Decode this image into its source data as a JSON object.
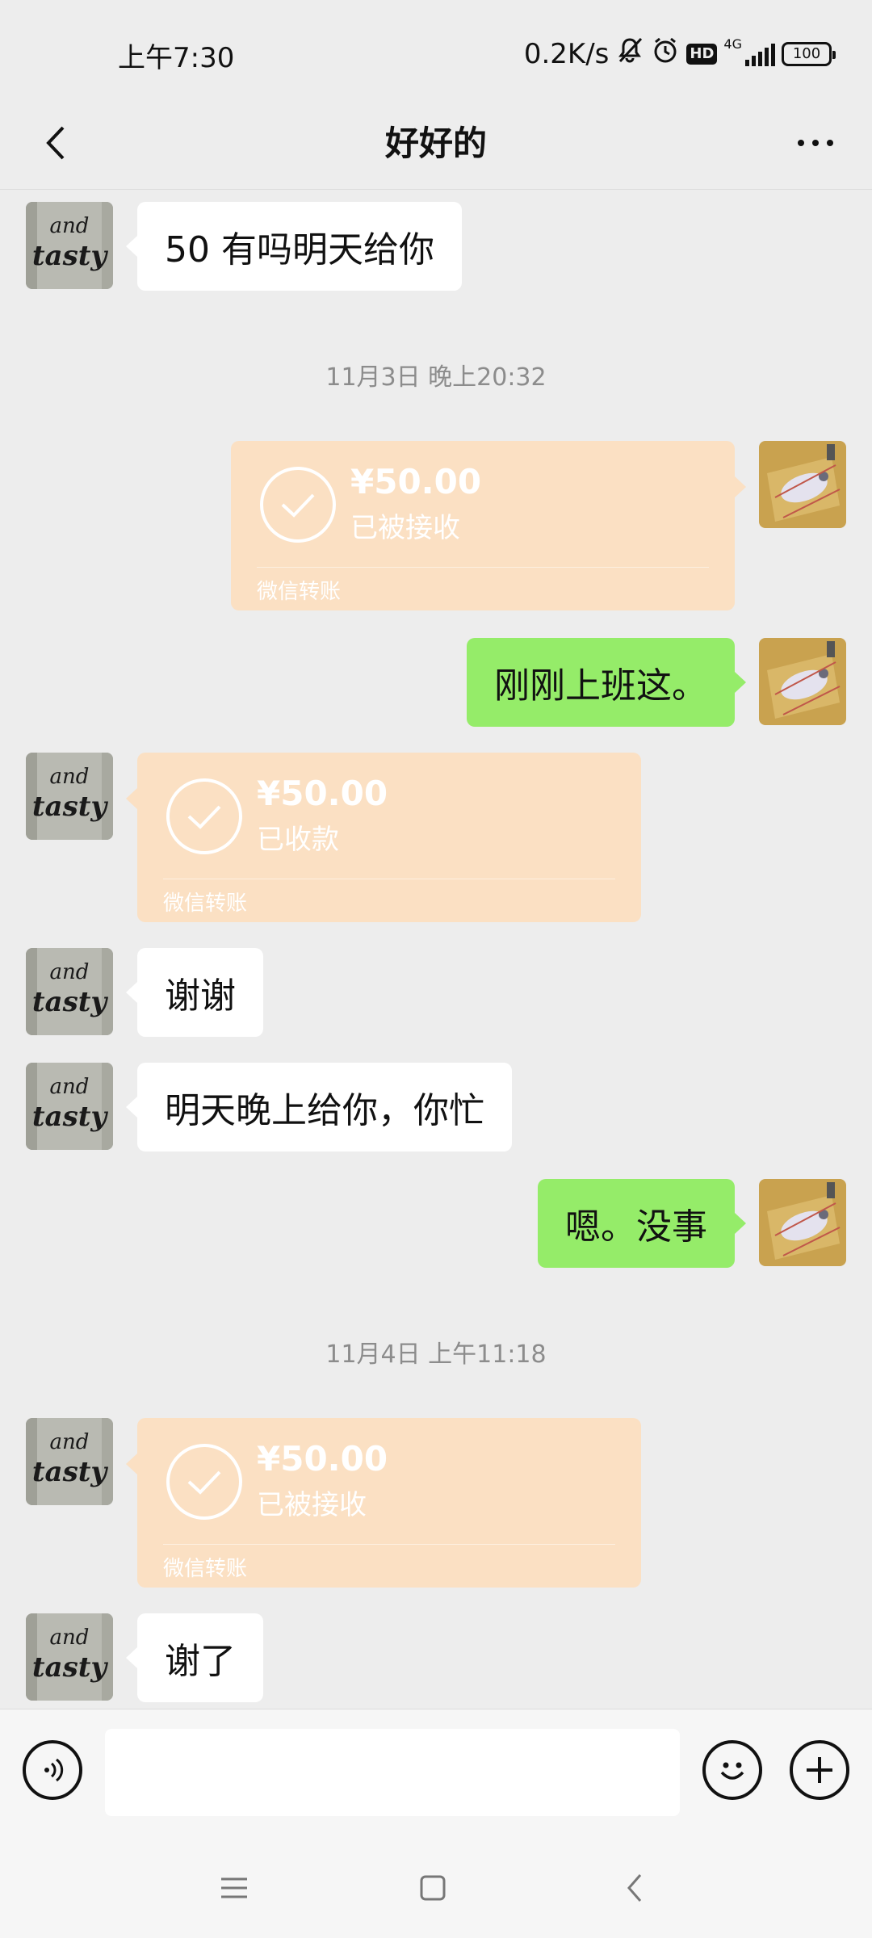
{
  "status_bar": {
    "time": "上午7:30",
    "speed": "0.2K/s",
    "network": "4G",
    "hd": "HD",
    "battery": "100"
  },
  "header": {
    "title": "好好的"
  },
  "messages": [
    {
      "type": "text",
      "side": "left",
      "text": "50 有吗明天给你"
    },
    {
      "type": "time",
      "text": "11月3日 晚上20:32"
    },
    {
      "type": "transfer",
      "side": "right",
      "amount": "¥50.00",
      "status": "已被接收",
      "label": "微信转账"
    },
    {
      "type": "text",
      "side": "right",
      "text": "刚刚上班这。"
    },
    {
      "type": "transfer",
      "side": "left",
      "amount": "¥50.00",
      "status": "已收款",
      "label": "微信转账"
    },
    {
      "type": "text",
      "side": "left",
      "text": "谢谢"
    },
    {
      "type": "text",
      "side": "left",
      "text": "明天晚上给你，你忙"
    },
    {
      "type": "text",
      "side": "right",
      "text": "嗯。没事"
    },
    {
      "type": "time",
      "text": "11月4日 上午11:18"
    },
    {
      "type": "transfer",
      "side": "left",
      "amount": "¥50.00",
      "status": "已被接收",
      "label": "微信转账"
    },
    {
      "type": "text",
      "side": "left",
      "text": "谢了"
    }
  ],
  "input": {
    "value": "",
    "placeholder": ""
  },
  "avatars": {
    "contact_text": "and tasty"
  },
  "colors": {
    "background": "#ededed",
    "sent_bubble": "#95ec69",
    "received_bubble": "#ffffff",
    "transfer_card": "#fbe0c3"
  }
}
